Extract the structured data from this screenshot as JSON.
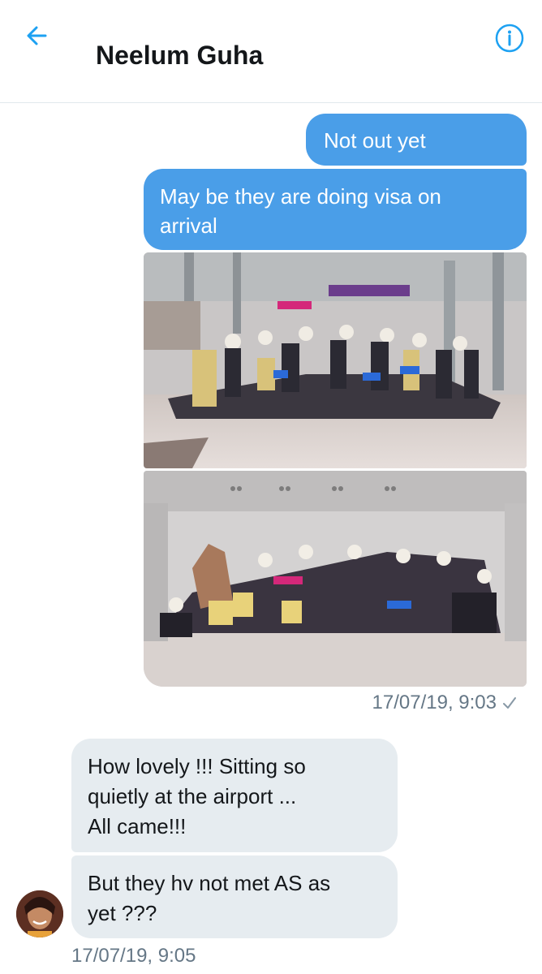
{
  "header": {
    "contact_name": "Neelum Guha",
    "back_icon": "arrow-left-icon",
    "info_icon": "info-circle-icon",
    "accent_color": "#1da1f2"
  },
  "messages": {
    "outgoing": [
      {
        "text": "Not out yet"
      },
      {
        "text": "May be they are doing visa on\narrival"
      }
    ],
    "outgoing_timestamp": "17/07/19, 9:03",
    "outgoing_status_icon": "checkmark-icon",
    "incoming": [
      {
        "text": "How lovely !!! Sitting so\nquietly at the airport ...\nAll came!!!"
      },
      {
        "text": "But they hv not met AS as\nyet ???"
      }
    ],
    "incoming_timestamp": "17/07/19, 9:05"
  },
  "colors": {
    "outgoing_bubble": "#4a9ee8",
    "incoming_bubble": "#e6ecf0",
    "timestamp": "#657786"
  }
}
